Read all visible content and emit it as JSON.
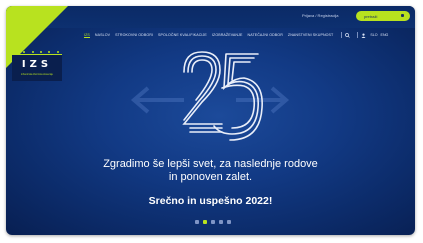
{
  "header": {
    "login_text": "Prijava / Registracija",
    "search_placeholder": "pretraži"
  },
  "nav": {
    "items": [
      "IZS",
      "NASLOV",
      "STROKOVNI ODBORI",
      "SPOLOČNE KVALIFIKACIJE",
      "IZOBRAŽEVANJE",
      "NATEČAJNI ODBOR",
      "ZNANSTVENI SKUPNOST"
    ],
    "active_index": 0,
    "lang_slo": "SLO",
    "lang_eng": "ENG"
  },
  "logo": {
    "text": "IZS",
    "subtitle": "inženirska zbornica slovenije"
  },
  "hero": {
    "number": "25",
    "headline_line1": "Zgradimo še lepši svet, za naslednje rodove",
    "headline_line2": "in ponoven zalet.",
    "greeting": "Srečno in uspešno 2022!"
  },
  "carousel": {
    "count": 5,
    "active_index": 1
  },
  "colors": {
    "accent": "#b8e21f",
    "background": "#123a85"
  }
}
